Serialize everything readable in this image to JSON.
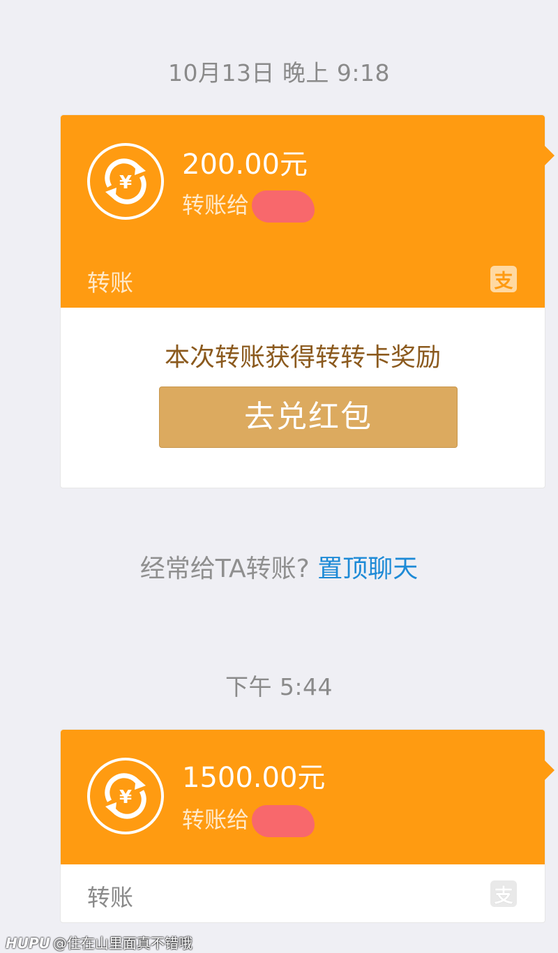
{
  "messages": [
    {
      "timestamp": "10月13日 晚上 9:18",
      "amount": "200.00元",
      "recipient_prefix": "转账给",
      "type_label": "转账",
      "badge_glyph": "支",
      "reward_text": "本次转账获得转转卡奖励",
      "redeem_button": "去兑红包"
    },
    {
      "timestamp": "下午 5:44",
      "amount": "1500.00元",
      "recipient_prefix": "转账给",
      "type_label": "转账",
      "badge_glyph": "支"
    }
  ],
  "pin_hint": {
    "text": "经常给TA转账?",
    "link": "置顶聊天"
  },
  "watermark": {
    "brand": "HUPU",
    "user": "@住在山里面真不错哦"
  },
  "colors": {
    "card_orange": "#ff9b11",
    "redeem_gold": "#dcaa5f",
    "link_blue": "#1d8ad6",
    "redaction_pink": "#f8686c"
  },
  "icons": {
    "transfer": "yuan-exchange-icon",
    "alipay": "alipay-logo-icon"
  }
}
